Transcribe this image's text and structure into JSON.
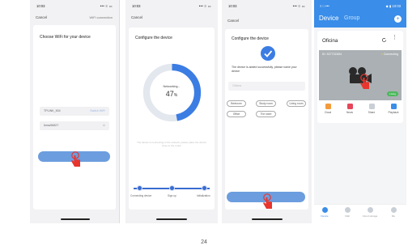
{
  "status_time": "10:03",
  "status_icons": "••• ≡ ▭",
  "cancel_label": "Cancel",
  "s1": {
    "nav_right": "WiFi connection",
    "title": "Choose WiFi for your device",
    "wifi_value": "TPLINK_504",
    "wifi_side": "Switch WiFi",
    "pass_value": "Ikmw56827",
    "pass_side": "⊙"
  },
  "s2": {
    "title": "Configure the device",
    "ring_caption": "Networking...",
    "percent": "47",
    "percent_unit": "%",
    "progress_value": 0.47,
    "hint": "The device is connecting to the network, please place the device close to the router",
    "steps": [
      "Connecting device",
      "Sign up",
      "Initialization"
    ]
  },
  "s3": {
    "title": "Configure the device",
    "success": "The device is added successfully, please name your device",
    "name_placeholder": "Oficina",
    "chips_row1": [
      "Bedroom",
      "Study room",
      "Living room"
    ],
    "chips_row2": [
      "Office",
      "The store"
    ]
  },
  "s4": {
    "status_left": "≡ □ •••",
    "status_right": "◆ ▮ 10:03",
    "tab_device": "Device",
    "tab_group": "Group",
    "plus": "+",
    "device_name": "Oficina",
    "device_id": "ID: 52772ZA54",
    "device_status": "Connecting",
    "live_label": "Living",
    "features": [
      {
        "label": "Cloud",
        "color": "#f29b3c"
      },
      {
        "label": "News",
        "color": "#e6465a"
      },
      {
        "label": "Share",
        "color": "#c9cfd6"
      },
      {
        "label": "Playback",
        "color": "#3b8de8"
      }
    ],
    "tabs": [
      "Device",
      "Mall",
      "Cloud storage",
      "Me"
    ],
    "active_tab_color": "#3a8de8"
  },
  "page_number": "24",
  "colors": {
    "accent": "#3b7de3",
    "button": "#6c9dde",
    "header": "#3a8de8",
    "hand": "#e8352e"
  }
}
